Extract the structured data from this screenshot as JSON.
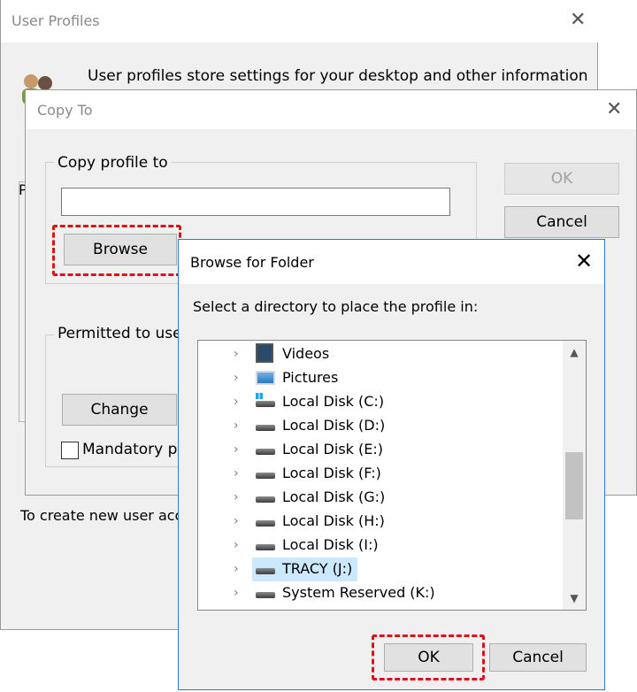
{
  "user_profiles": {
    "title": "User Profiles",
    "description": "User profiles store settings for your desktop and other information",
    "group_partial_label": "P",
    "bottom_text": "To create new user acc"
  },
  "copy_to": {
    "title": "Copy To",
    "copy_profile_to_label": "Copy profile to",
    "path_value": "",
    "browse_label": "Browse",
    "permitted_label": "Permitted to use",
    "change_label": "Change",
    "mandatory_label": "Mandatory pr",
    "ok_label": "OK",
    "cancel_label": "Cancel"
  },
  "browse_for_folder": {
    "title": "Browse for Folder",
    "prompt": "Select a directory to place the profile in:",
    "ok_label": "OK",
    "cancel_label": "Cancel",
    "items": [
      {
        "label": "Videos",
        "icon": "videos-icon",
        "selected": false
      },
      {
        "label": "Pictures",
        "icon": "pictures-icon",
        "selected": false
      },
      {
        "label": "Local Disk (C:)",
        "icon": "windows-drive-icon",
        "selected": false
      },
      {
        "label": "Local Disk (D:)",
        "icon": "drive-icon",
        "selected": false
      },
      {
        "label": "Local Disk (E:)",
        "icon": "drive-icon",
        "selected": false
      },
      {
        "label": "Local Disk (F:)",
        "icon": "drive-icon",
        "selected": false
      },
      {
        "label": "Local Disk (G:)",
        "icon": "drive-icon",
        "selected": false
      },
      {
        "label": "Local Disk (H:)",
        "icon": "drive-icon",
        "selected": false
      },
      {
        "label": "Local Disk (I:)",
        "icon": "drive-icon",
        "selected": false
      },
      {
        "label": "TRACY (J:)",
        "icon": "drive-icon",
        "selected": true
      },
      {
        "label": "System Reserved (K:)",
        "icon": "drive-icon",
        "selected": false
      }
    ]
  },
  "colors": {
    "highlight_dash": "#d9141b",
    "selection": "#cce8ff",
    "dialog_border": "#2b79d6"
  }
}
